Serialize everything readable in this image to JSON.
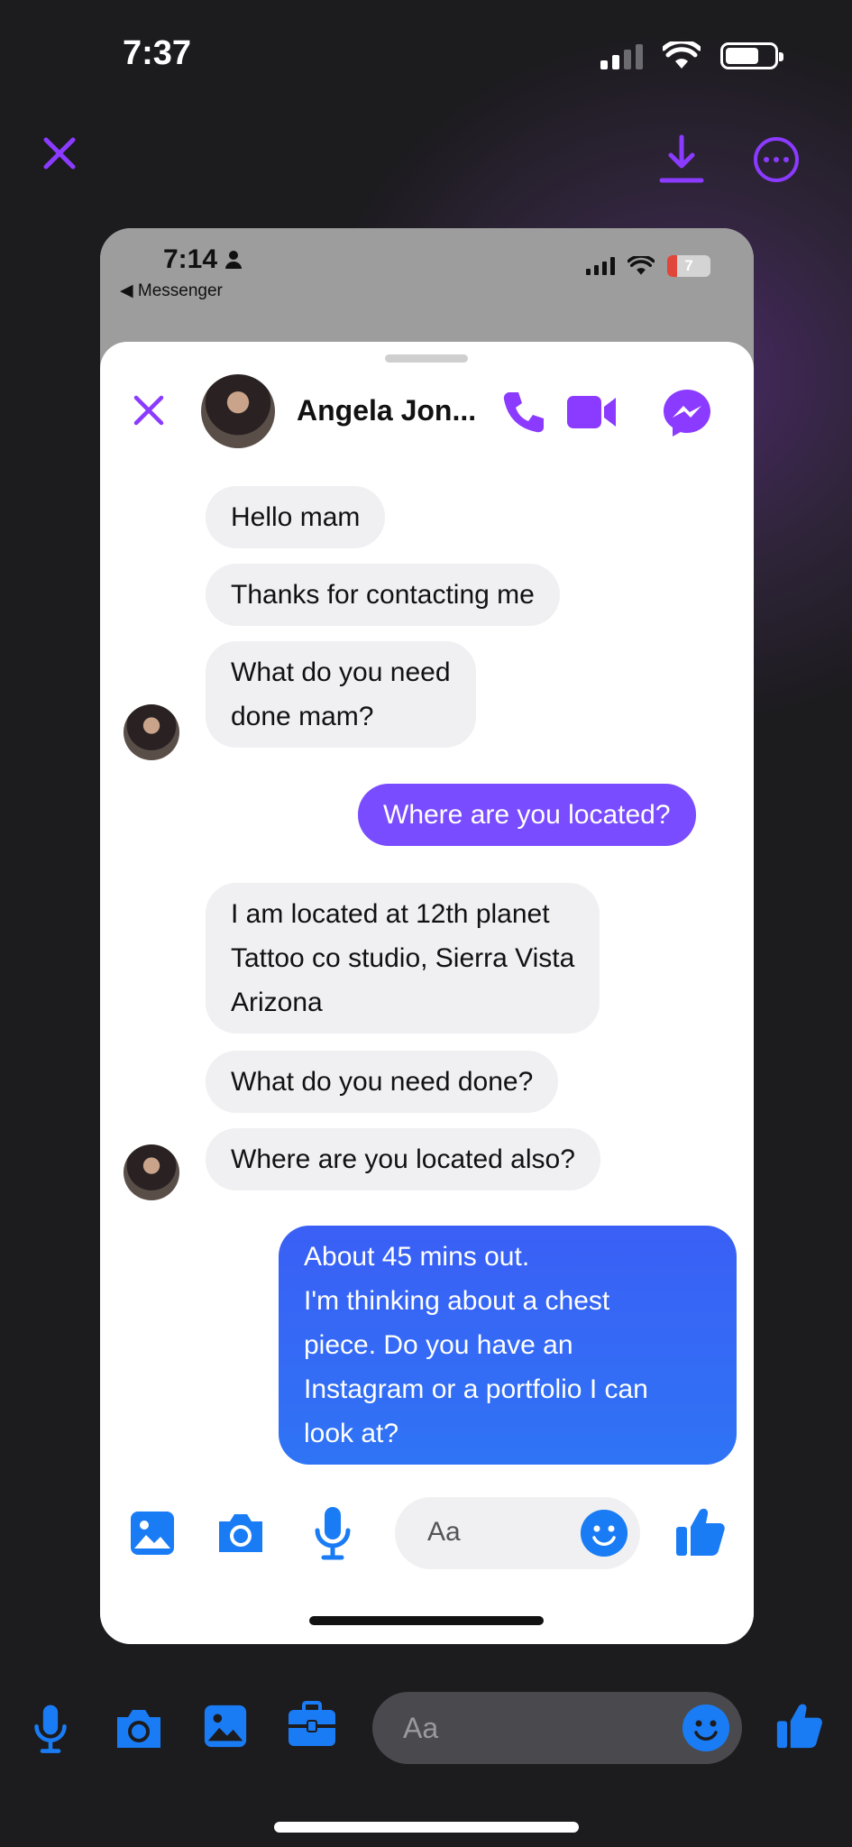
{
  "outer": {
    "time": "7:37",
    "input_placeholder": "Aa"
  },
  "inner": {
    "time": "7:14",
    "back_label": "◀ Messenger",
    "battery": "7",
    "contact_name": "Angela Jon...",
    "input_placeholder": "Aa"
  },
  "messages": [
    {
      "text": "Hello mam",
      "direction": "in"
    },
    {
      "text": "Thanks for contacting me",
      "direction": "in"
    },
    {
      "lines": [
        "What do you need",
        "done mam?"
      ],
      "direction": "in"
    },
    {
      "text": "Where are you located?",
      "direction": "out"
    },
    {
      "lines": [
        "I am located at 12th planet",
        "Tattoo co studio, Sierra Vista",
        "Arizona"
      ],
      "direction": "in"
    },
    {
      "text": "What do you need done?",
      "direction": "in"
    },
    {
      "text": "Where are you located also?",
      "direction": "in"
    },
    {
      "lines": [
        "About 45 mins out.",
        "I'm thinking about a chest",
        "piece. Do you have an",
        "Instagram or a portfolio I can",
        "look at?"
      ],
      "direction": "out"
    }
  ],
  "colors": {
    "accent_purple": "#8b3bff",
    "messenger_blue": "#1a7cf5",
    "outgoing_purple": "#7a4cff",
    "outgoing_blue": "#2f6cf5"
  },
  "icons": {
    "outer_top": [
      "close-icon",
      "download-icon",
      "more-options-icon"
    ],
    "header": [
      "close-icon",
      "phone-call-icon",
      "video-call-icon",
      "messenger-icon"
    ],
    "composer": [
      "photo-icon",
      "camera-icon",
      "microphone-icon",
      "emoji-icon",
      "thumbs-up-icon"
    ],
    "outer_bottom": [
      "microphone-icon",
      "camera-icon",
      "photo-icon",
      "briefcase-icon",
      "emoji-icon",
      "thumbs-up-icon"
    ]
  }
}
